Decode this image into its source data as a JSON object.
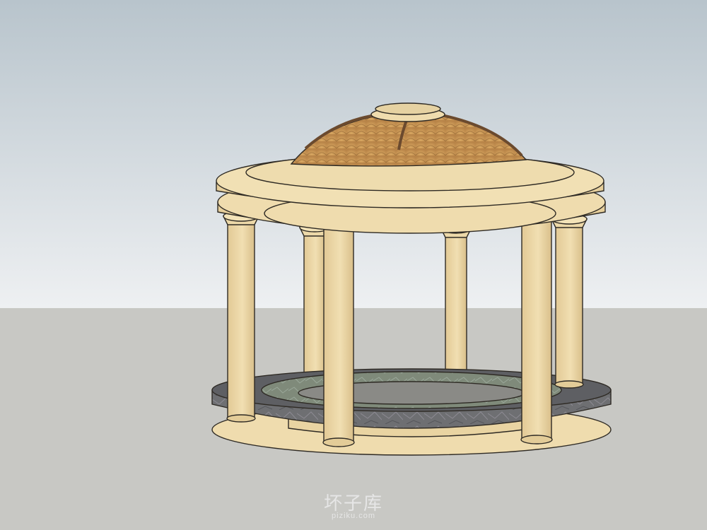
{
  "colors": {
    "sky_top": "#b8c4cc",
    "sky_bottom": "#eef0f2",
    "ground": "#c8c8c4",
    "stone": "#efdcae",
    "stone_shadow": "#d8c08c",
    "dome": "#c99a5e",
    "rib": "#6b4a2e",
    "marble": "#6e6f72",
    "outline": "#2e2a24"
  },
  "watermark": {
    "title": "坏子库",
    "site": "piziku.com"
  },
  "icons": [
    "gazebo-model"
  ]
}
